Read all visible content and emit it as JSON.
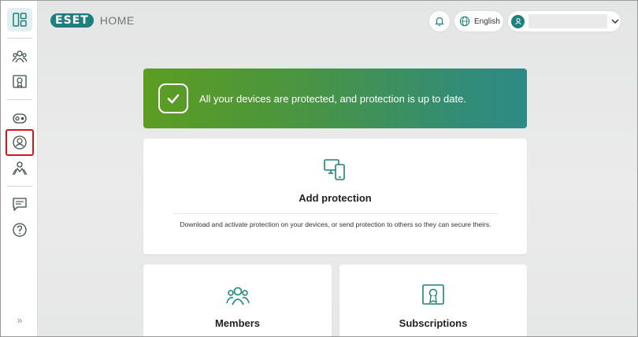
{
  "header": {
    "brand": "ESET",
    "product": "HOME",
    "language": "English",
    "account_name": ""
  },
  "sidebar": {
    "items": [
      {
        "name": "dashboard",
        "active": true
      },
      {
        "name": "members"
      },
      {
        "name": "subscriptions"
      },
      {
        "name": "devices"
      },
      {
        "name": "security"
      },
      {
        "name": "shared-protection"
      },
      {
        "name": "feedback"
      },
      {
        "name": "help"
      }
    ],
    "expand_glyph": "»"
  },
  "banner": {
    "message": "All your devices are protected, and protection is up to date."
  },
  "cards": {
    "add_protection": {
      "title": "Add protection",
      "description": "Download and activate protection on your devices, or send protection to others so they can secure theirs."
    },
    "members": {
      "title": "Members"
    },
    "subscriptions": {
      "title": "Subscriptions"
    }
  },
  "colors": {
    "brand": "#1d807c",
    "banner_start": "#5c9d22",
    "banner_end": "#2d8a86",
    "highlight": "#d8141a"
  }
}
